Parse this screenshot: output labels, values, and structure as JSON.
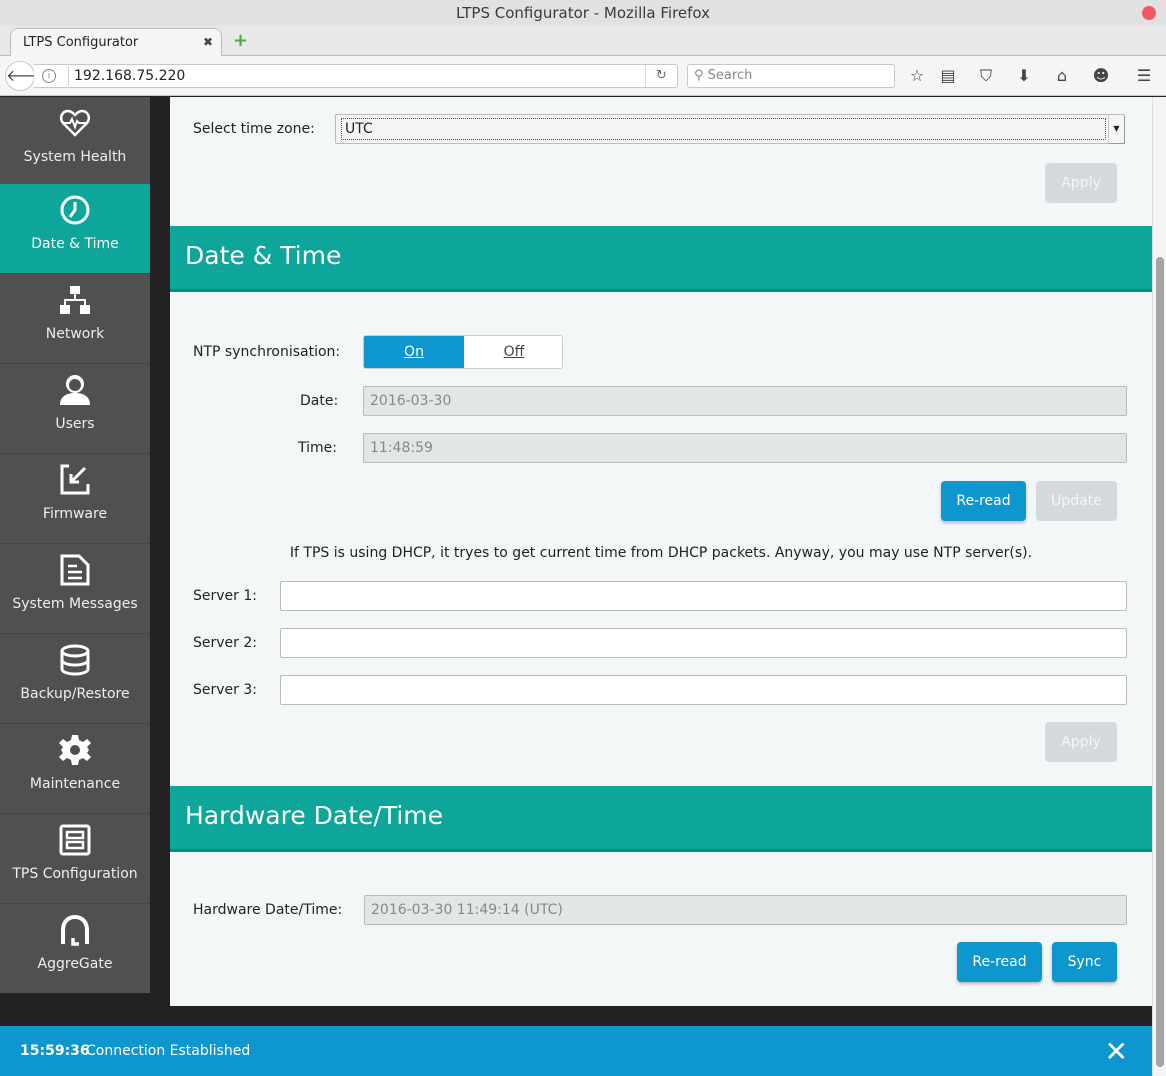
{
  "window": {
    "title": "LTPS Configurator - Mozilla Firefox"
  },
  "browser": {
    "tab_label": "LTPS Configurator",
    "tab_close": "✖",
    "new_tab": "+",
    "url": "192.168.75.220",
    "search_placeholder": "Search",
    "icons": [
      "back-icon",
      "info-icon",
      "reload-icon",
      "search-icon",
      "bookmark-star-icon",
      "reading-list-icon",
      "pocket-icon",
      "download-icon",
      "home-icon",
      "chat-icon",
      "menu-icon"
    ]
  },
  "sidebar": {
    "items": [
      {
        "label": "System Health",
        "icon": "heartbeat-icon",
        "active": false
      },
      {
        "label": "Date & Time",
        "icon": "clock-icon",
        "active": true
      },
      {
        "label": "Network",
        "icon": "network-icon",
        "active": false
      },
      {
        "label": "Users",
        "icon": "user-icon",
        "active": false
      },
      {
        "label": "Firmware",
        "icon": "firmware-import-icon",
        "active": false
      },
      {
        "label": "System Messages",
        "icon": "document-icon",
        "active": false
      },
      {
        "label": "Backup/Restore",
        "icon": "database-icon",
        "active": false
      },
      {
        "label": "Maintenance",
        "icon": "gear-icon",
        "active": false
      },
      {
        "label": "TPS Configuration",
        "icon": "config-icon",
        "active": false
      },
      {
        "label": "AggreGate",
        "icon": "aggregate-icon",
        "active": false
      }
    ]
  },
  "timezone": {
    "label": "Select time zone:",
    "selected": "UTC",
    "apply_label": "Apply"
  },
  "date_time": {
    "title": "Date & Time",
    "ntp_label": "NTP synchronisation:",
    "ntp_on": "On",
    "ntp_off": "Off",
    "ntp_state": "On",
    "date_label": "Date:",
    "date_value": "2016-03-30",
    "time_label": "Time:",
    "time_value": "11:48:59",
    "reread_label": "Re-read",
    "update_label": "Update",
    "hint": "If TPS is using DHCP, it tryes to get current time from DHCP packets. Anyway, you may use NTP server(s).",
    "servers": [
      {
        "label": "Server 1:",
        "value": ""
      },
      {
        "label": "Server 2:",
        "value": ""
      },
      {
        "label": "Server 3:",
        "value": ""
      }
    ],
    "apply_label": "Apply"
  },
  "hardware": {
    "title": "Hardware Date/Time",
    "label": "Hardware Date/Time:",
    "value": "2016-03-30 11:49:14 (UTC)",
    "reread_label": "Re-read",
    "sync_label": "Sync"
  },
  "notification": {
    "time": "15:59:36",
    "message": "Connection Established",
    "close": "✕"
  },
  "colors": {
    "accent_teal": "#0ea59a",
    "primary_blue": "#0e96ce",
    "sidebar_bg": "#505050",
    "disabled_btn": "#d5d9db"
  }
}
